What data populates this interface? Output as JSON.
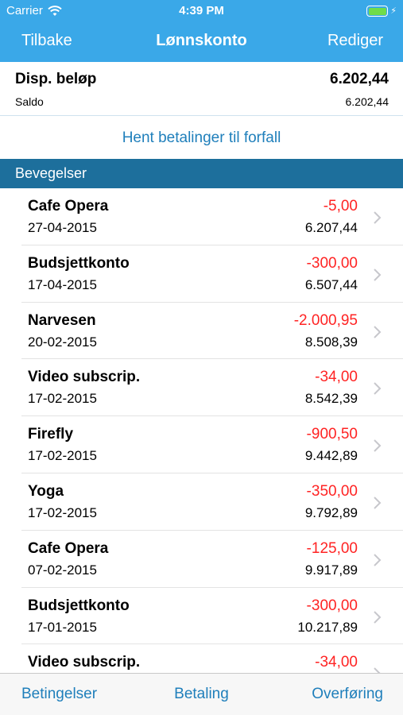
{
  "status_bar": {
    "carrier": "Carrier",
    "time": "4:39 PM",
    "battery_level": 1.0,
    "battery_color": "#6fdc4a",
    "icons": [
      "wifi-icon",
      "battery-icon",
      "charging-bolt-icon"
    ]
  },
  "nav": {
    "back_label": "Tilbake",
    "title": "Lønnskonto",
    "edit_label": "Rediger",
    "background": "#3aa8e8"
  },
  "summary": {
    "available_label": "Disp. beløp",
    "available_value": "6.202,44",
    "balance_label": "Saldo",
    "balance_value": "6.202,44"
  },
  "fetch_payments_label": "Hent betalinger til forfall",
  "section": {
    "title": "Bevegelser",
    "background": "#1d6f9c"
  },
  "transactions": [
    {
      "name": "Cafe Opera",
      "date": "27-04-2015",
      "amount": "-5,00",
      "balance": "6.207,44"
    },
    {
      "name": "Budsjettkonto",
      "date": "17-04-2015",
      "amount": "-300,00",
      "balance": "6.507,44"
    },
    {
      "name": "Narvesen",
      "date": "20-02-2015",
      "amount": "-2.000,95",
      "balance": "8.508,39"
    },
    {
      "name": "Video subscrip.",
      "date": "17-02-2015",
      "amount": "-34,00",
      "balance": "8.542,39"
    },
    {
      "name": "Firefly",
      "date": "17-02-2015",
      "amount": "-900,50",
      "balance": "9.442,89"
    },
    {
      "name": "Yoga",
      "date": "17-02-2015",
      "amount": "-350,00",
      "balance": "9.792,89"
    },
    {
      "name": "Cafe Opera",
      "date": "07-02-2015",
      "amount": "-125,00",
      "balance": "9.917,89"
    },
    {
      "name": "Budsjettkonto",
      "date": "17-01-2015",
      "amount": "-300,00",
      "balance": "10.217,89"
    },
    {
      "name": "Video subscrip.",
      "date": "",
      "amount": "-34,00",
      "balance": ""
    }
  ],
  "colors": {
    "negative_amount": "#ff2323",
    "link": "#1f7fbb"
  },
  "toolbar": {
    "conditions_label": "Betingelser",
    "payment_label": "Betaling",
    "transfer_label": "Overføring"
  }
}
